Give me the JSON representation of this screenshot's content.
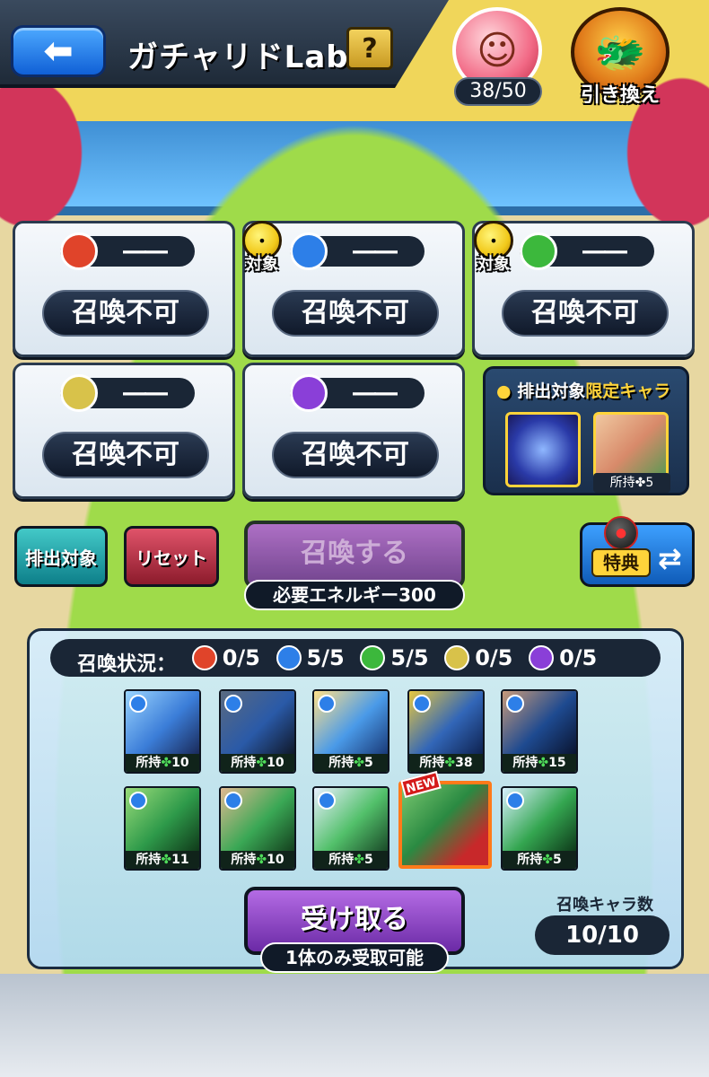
{
  "header": {
    "title": "ガチャリドLab.",
    "back_icon": "back-arrow-icon",
    "help_label": "?",
    "stamina": "38/50",
    "exchange_label": "引き換え"
  },
  "panels": [
    {
      "attribute": "fire",
      "color": "#e0442a",
      "value": "――",
      "status": "召喚不可",
      "target": false
    },
    {
      "attribute": "water",
      "color": "#2d7fe8",
      "value": "――",
      "status": "召喚不可",
      "target": true
    },
    {
      "attribute": "wood",
      "color": "#3cb83c",
      "value": "――",
      "status": "召喚不可",
      "target": true
    },
    {
      "attribute": "light",
      "color": "#d8c24a",
      "value": "――",
      "status": "召喚不可",
      "target": false
    },
    {
      "attribute": "dark",
      "color": "#8a3fd8",
      "value": "――",
      "status": "召喚不可",
      "target": false
    }
  ],
  "target_label": "対象",
  "limited": {
    "title_prefix": "排出対象",
    "title_highlight": "限定キャラ",
    "owned": "所持✤5"
  },
  "buttons": {
    "target": "排出対象",
    "reset": "リセット",
    "summon": "召喚する",
    "energy": "必要エネルギー300",
    "bonus": "特典",
    "receive": "受け取る",
    "receive_note": "1体のみ受取可能"
  },
  "summon_status": {
    "label": "召喚状況：",
    "counts": [
      {
        "attribute": "fire",
        "color": "#e0442a",
        "value": "0/5"
      },
      {
        "attribute": "water",
        "color": "#2d7fe8",
        "value": "5/5"
      },
      {
        "attribute": "wood",
        "color": "#3cb83c",
        "value": "5/5"
      },
      {
        "attribute": "light",
        "color": "#d8c24a",
        "value": "0/5"
      },
      {
        "attribute": "dark",
        "color": "#8a3fd8",
        "value": "0/5"
      }
    ]
  },
  "characters_row1": [
    {
      "owned": "所持",
      "count": "10",
      "color": "#3b7dd8"
    },
    {
      "owned": "所持",
      "count": "10",
      "color": "#2a5aa8"
    },
    {
      "owned": "所持",
      "count": "5",
      "color": "#4a9ae8"
    },
    {
      "owned": "所持",
      "count": "38",
      "color": "#3266b8"
    },
    {
      "owned": "所持",
      "count": "15",
      "color": "#1e4a90"
    }
  ],
  "characters_row2": [
    {
      "owned": "所持",
      "count": "11",
      "color": "#2e9a4a",
      "new": false
    },
    {
      "owned": "所持",
      "count": "10",
      "color": "#3aa855",
      "new": false
    },
    {
      "owned": "所持",
      "count": "5",
      "color": "#52c06a",
      "new": false
    },
    {
      "owned": "",
      "count": "",
      "color": "#2a8a42",
      "new": true
    },
    {
      "owned": "所持",
      "count": "5",
      "color": "#34a650",
      "new": false
    }
  ],
  "new_tag": "NEW",
  "summon_count": {
    "label": "召喚キャラ数",
    "value": "10/10"
  }
}
